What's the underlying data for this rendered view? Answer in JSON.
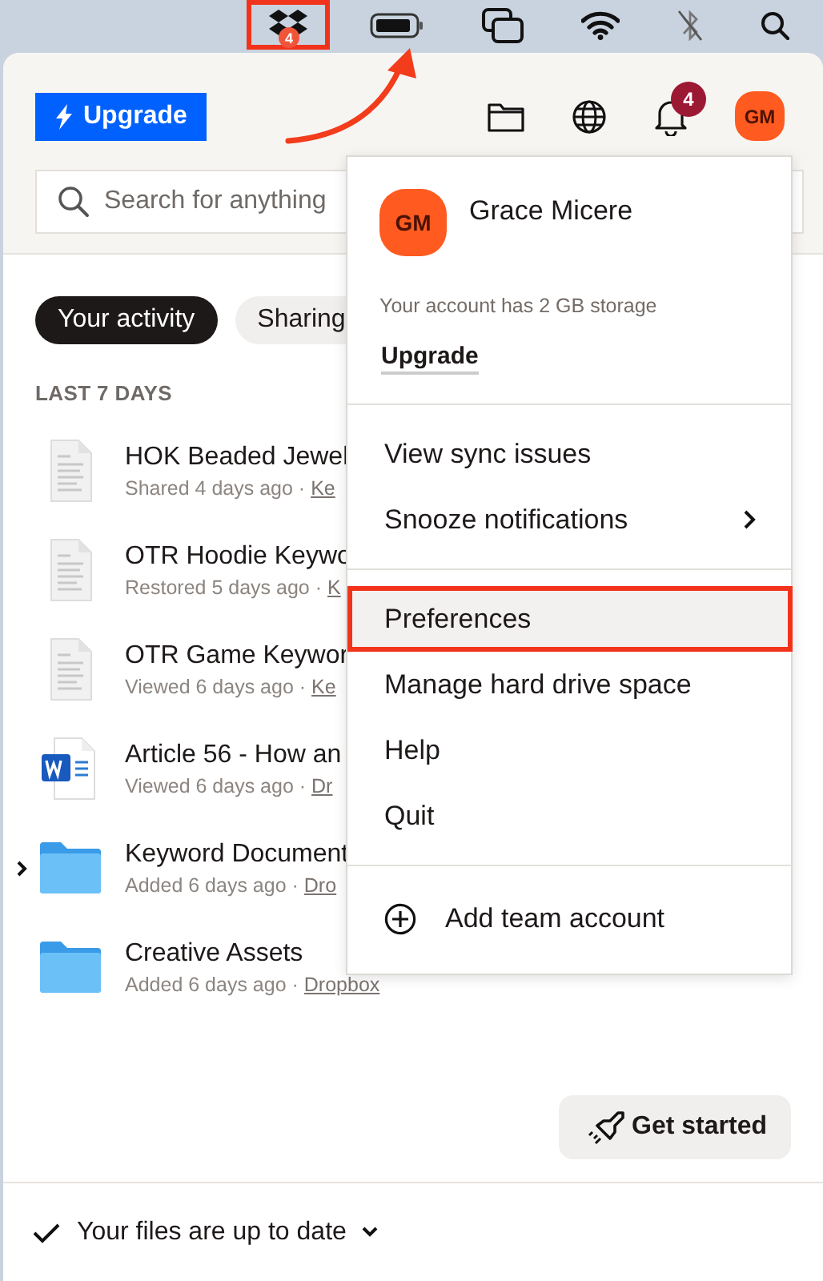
{
  "menubar": {
    "items": [
      {
        "kind": "dropbox",
        "badge": "4",
        "highlighted": true
      },
      {
        "kind": "battery",
        "highlighted": false
      },
      {
        "kind": "screens",
        "highlighted": false
      },
      {
        "kind": "wifi",
        "highlighted": false
      },
      {
        "kind": "bluetooth",
        "highlighted": false
      },
      {
        "kind": "search",
        "highlighted": false
      }
    ]
  },
  "header": {
    "upgrade": "Upgrade",
    "notification_count": "4",
    "avatar": "GM",
    "search": {
      "placeholder": "Search for anything"
    }
  },
  "chips": [
    {
      "label": "Your activity",
      "selected": true
    },
    {
      "label": "Sharing",
      "selected": false
    }
  ],
  "section": "LAST 7 DAYS",
  "files": [
    {
      "kind": "document",
      "name": "HOK Beaded Jewel",
      "action": "Shared 4 days ago ·",
      "location": "Ke",
      "expandable": false
    },
    {
      "kind": "document",
      "name": "OTR Hoodie Keywo",
      "action": "Restored 5 days ago ·",
      "location": "K",
      "expandable": false
    },
    {
      "kind": "document",
      "name": "OTR Game Keywor",
      "action": "Viewed 6 days ago ·",
      "location": "Ke",
      "expandable": false
    },
    {
      "kind": "word",
      "name": "Article 56 - How an",
      "action": "Viewed 6 days ago ·",
      "location": "Dr",
      "expandable": false
    },
    {
      "kind": "folder",
      "name": "Keyword Document",
      "action": "Added 6 days ago ·",
      "location": "Dro",
      "expandable": true
    },
    {
      "kind": "folder",
      "name": "Creative Assets",
      "action": "Added 6 days ago ·",
      "location": "Dropbox",
      "expandable": false
    }
  ],
  "get_started": "Get started",
  "status": "Your files are up to date",
  "menu": {
    "avatar": "GM",
    "name": "Grace Micere",
    "storage": "Your account has 2 GB storage",
    "upgrade": "Upgrade",
    "groups": [
      [
        {
          "label": "View sync issues",
          "submenu": false,
          "highlighted": false
        },
        {
          "label": "Snooze notifications",
          "submenu": true,
          "highlighted": false
        }
      ],
      [
        {
          "label": "Preferences",
          "submenu": false,
          "highlighted": true
        },
        {
          "label": "Manage hard drive space",
          "submenu": false,
          "highlighted": false
        },
        {
          "label": "Help",
          "submenu": false,
          "highlighted": false
        },
        {
          "label": "Quit",
          "submenu": false,
          "highlighted": false
        }
      ]
    ],
    "add_account": "Add team account"
  }
}
